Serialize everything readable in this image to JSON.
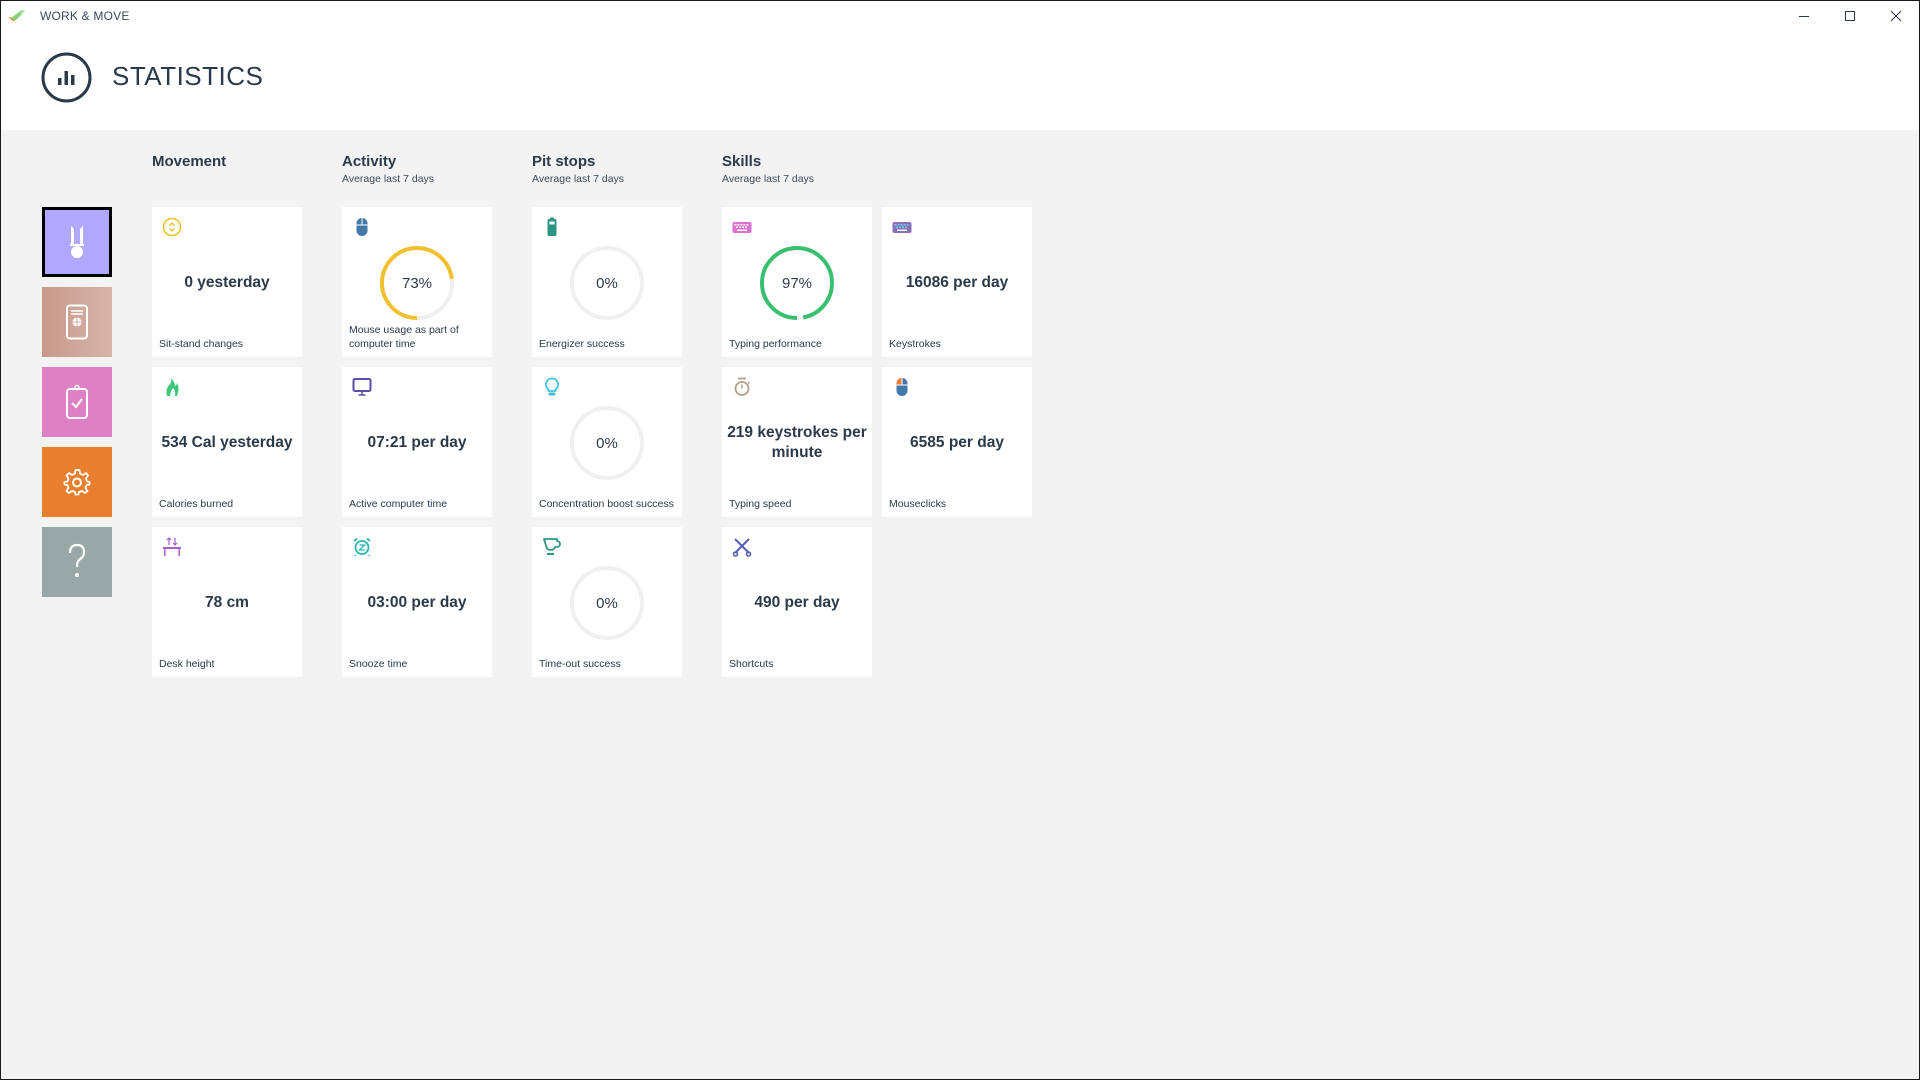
{
  "window": {
    "app_title": "WORK & MOVE",
    "controls": {
      "minimize": "minimize",
      "maximize": "maximize",
      "close": "close"
    }
  },
  "header": {
    "title": "STATISTICS",
    "icon": "bar-chart-circle-icon"
  },
  "sidebar": {
    "items": [
      {
        "name": "medal",
        "icon": "medal-icon",
        "color": "#b0a8ff",
        "active": true
      },
      {
        "name": "passport",
        "icon": "passport-icon",
        "color": "#c99d8e",
        "active": false
      },
      {
        "name": "clipboard",
        "icon": "clipboard-check-icon",
        "color": "#dd80c4",
        "active": false
      },
      {
        "name": "settings",
        "icon": "gear-icon",
        "color": "#e87f2f",
        "active": false
      },
      {
        "name": "help",
        "icon": "question-icon",
        "color": "#98a8a7",
        "active": false
      }
    ]
  },
  "sections": [
    {
      "title": "Movement",
      "subtitle": ""
    },
    {
      "title": "Activity",
      "subtitle": "Average last 7 days"
    },
    {
      "title": "Pit stops",
      "subtitle": "Average last 7 days"
    },
    {
      "title": "Skills",
      "subtitle": "Average last 7 days"
    }
  ],
  "cards": {
    "sit_stand": {
      "value": "0 yesterday",
      "label": "Sit-stand changes",
      "icon": "up-down-circle-icon",
      "color": "#f0c030"
    },
    "calories": {
      "value": "534 Cal yesterday",
      "label": "Calories burned",
      "icon": "flame-icon",
      "color": "#3cc878"
    },
    "desk_height": {
      "value": "78 cm",
      "label": "Desk height",
      "icon": "desk-height-icon",
      "color": "#a860c8"
    },
    "mouse_usage": {
      "value": "73%",
      "percent": 73,
      "label": "Mouse usage as part of computer time",
      "icon": "mouse-icon",
      "color": "#f0c030"
    },
    "active_time": {
      "value": "07:21 per day",
      "label": "Active computer time",
      "icon": "monitor-icon",
      "color": "#5a4ea8"
    },
    "snooze": {
      "value": "03:00 per day",
      "label": "Snooze time",
      "icon": "alarm-clock-icon",
      "color": "#28b8b0"
    },
    "energizer": {
      "value": "0%",
      "percent": 0,
      "label": "Energizer success",
      "icon": "battery-icon",
      "color": "#2e9484"
    },
    "concentration": {
      "value": "0%",
      "percent": 0,
      "label": "Concentration boost success",
      "icon": "lightbulb-icon",
      "color": "#40c0d8"
    },
    "timeout": {
      "value": "0%",
      "percent": 0,
      "label": "Time-out success",
      "icon": "cup-icon",
      "color": "#2e9484"
    },
    "typing_perf": {
      "value": "97%",
      "percent": 97,
      "label": "Typing performance",
      "icon": "keyboard-icon",
      "color": "#38c070"
    },
    "keystrokes": {
      "value": "16086 per day",
      "label": "Keystrokes",
      "icon": "keyboard-icon",
      "color": "#8a70b8"
    },
    "typing_speed": {
      "value": "219 keystrokes per minute",
      "label": "Typing speed",
      "icon": "stopwatch-icon",
      "color": "#b0a088"
    },
    "mouseclicks": {
      "value": "6585 per day",
      "label": "Mouseclicks",
      "icon": "mouse-click-icon",
      "color": "#4478a8"
    },
    "shortcuts": {
      "value": "490 per day",
      "label": "Shortcuts",
      "icon": "scissors-icon",
      "color": "#5a60b0"
    }
  },
  "colors": {
    "ring_track": "#f0f0f0",
    "text": "#2b3a4a",
    "background": "#f3f3f3"
  }
}
